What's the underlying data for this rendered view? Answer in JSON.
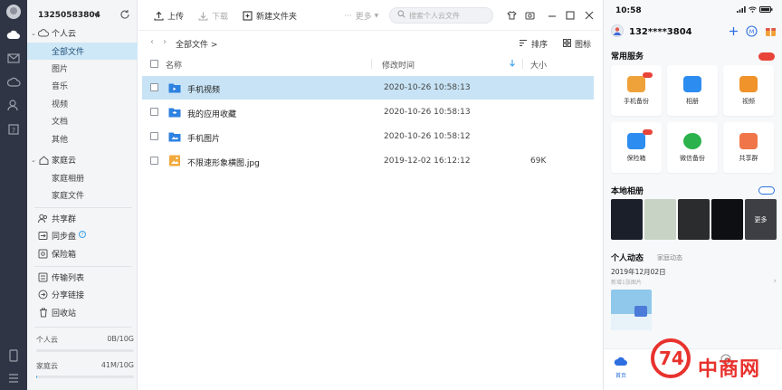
{
  "colors": {
    "rail_bg": "#2f3545",
    "sidebar_bg": "#f4f5f7",
    "selected_bg": "#c7e3f5",
    "active_nav_bg": "#cfe8f7",
    "accent_blue": "#3aa0e8",
    "folder_blue": "#2d82e0",
    "image_orange": "#f2a93b"
  },
  "sidebar": {
    "account": "13250583804",
    "personal_cloud": {
      "label": "个人云",
      "items": [
        "全部文件",
        "图片",
        "音乐",
        "视频",
        "文档",
        "其他"
      ]
    },
    "family_cloud": {
      "label": "家庭云",
      "items": [
        "家庭相册",
        "家庭文件"
      ]
    },
    "shared_label": "共享群",
    "sync_label": "同步盘",
    "safebox_label": "保险箱",
    "transfer_label": "传输列表",
    "share_link_label": "分享链接",
    "recycle_label": "回收站",
    "quota": [
      {
        "name": "个人云",
        "value": "0B/10G",
        "fraction": 0.0
      },
      {
        "name": "家庭云",
        "value": "41M/10G",
        "fraction": 0.004
      }
    ]
  },
  "toolbar": {
    "upload": "上传",
    "download": "下载",
    "new_folder": "新建文件夹",
    "more": "更多",
    "search_placeholder": "搜索个人云文件"
  },
  "breadcrumb": "全部文件 >",
  "view": {
    "sort": "排序",
    "icon_view": "图标"
  },
  "table": {
    "columns": {
      "name": "名称",
      "modified": "修改时间",
      "size": "大小"
    },
    "rows": [
      {
        "name": "手机视频",
        "modified": "2020-10-26 10:58:13",
        "size": "",
        "type": "folder"
      },
      {
        "name": "我的应用收藏",
        "modified": "2020-10-26 10:58:13",
        "size": "",
        "type": "folder"
      },
      {
        "name": "手机图片",
        "modified": "2020-10-26 10:58:12",
        "size": "",
        "type": "folder"
      },
      {
        "name": "不限速形象横图.jpg",
        "modified": "2019-12-02 16:12:12",
        "size": "69K",
        "type": "image"
      }
    ]
  },
  "phone": {
    "time": "10:58",
    "user": "132****3804",
    "services_title": "常用服务",
    "services": [
      "手机备份",
      "相册",
      "视频",
      "保险箱",
      "微信备份",
      "共享群"
    ],
    "album_title": "本地相册",
    "album_more": "更多",
    "activity_title": "个人动态",
    "activity_tab": "家庭动态",
    "activity_date": "2019年12月02日",
    "activity_caption": "新增1张图片",
    "tab_home": "首页"
  },
  "watermark": "中商网"
}
